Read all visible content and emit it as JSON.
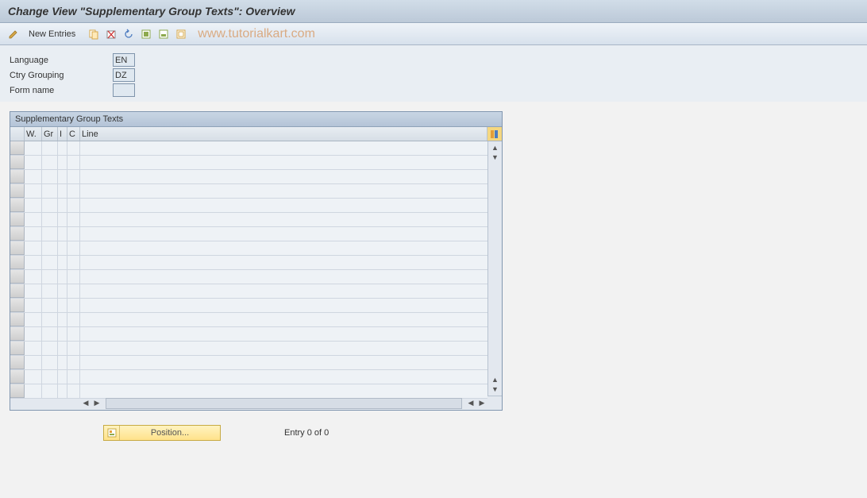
{
  "title": "Change View \"Supplementary Group Texts\": Overview",
  "toolbar": {
    "new_entries": "New Entries"
  },
  "watermark": "www.tutorialkart.com",
  "form": {
    "language_label": "Language",
    "language_value": "EN",
    "ctry_grouping_label": "Ctry Grouping",
    "ctry_grouping_value": "DZ",
    "form_name_label": "Form name",
    "form_name_value": ""
  },
  "table": {
    "title": "Supplementary Group Texts",
    "columns": {
      "w": "W.",
      "gr": "Gr",
      "i": "I",
      "c": "C",
      "line": "Line"
    },
    "row_count": 18
  },
  "position_button": "Position...",
  "entry_status": "Entry 0 of 0"
}
